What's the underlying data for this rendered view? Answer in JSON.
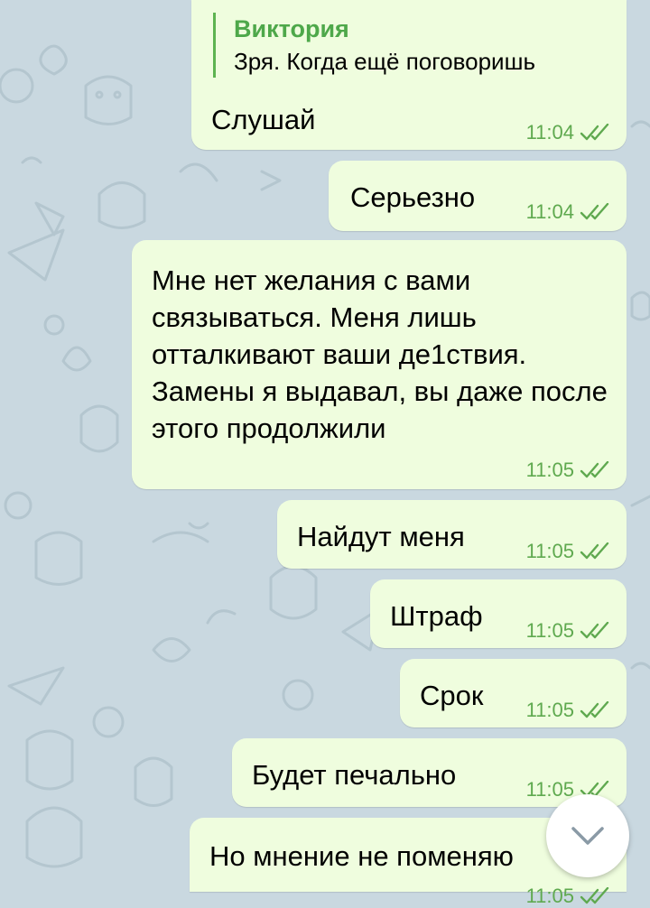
{
  "chat": {
    "messages": [
      {
        "reply": {
          "name": "Виктория",
          "text": "Зря. Когда ещё поговоришь"
        },
        "text": "Слушай",
        "time": "11:04"
      },
      {
        "text": "Серьезно",
        "time": "11:04"
      },
      {
        "text": "Мне нет желания с вами связываться. Меня лишь отталкивают ваши де1ствия. Замены я выдавал, вы даже после этого продолжили",
        "time": "11:05"
      },
      {
        "text": "Найдут меня",
        "time": "11:05"
      },
      {
        "text": "Штраф",
        "time": "11:05"
      },
      {
        "text": "Срок",
        "time": "11:05"
      },
      {
        "text": "Будет печально",
        "time": "11:05"
      },
      {
        "text": "Но мнение не поменяю",
        "time": "11:05"
      }
    ]
  },
  "icons": {
    "read_receipt": "double-check-icon",
    "scroll_down": "chevron-down-icon"
  },
  "colors": {
    "bubble": "#effdde",
    "time": "#5fa94f",
    "reply_name": "#4ea84a",
    "wallpaper": "#c9d8e0"
  }
}
